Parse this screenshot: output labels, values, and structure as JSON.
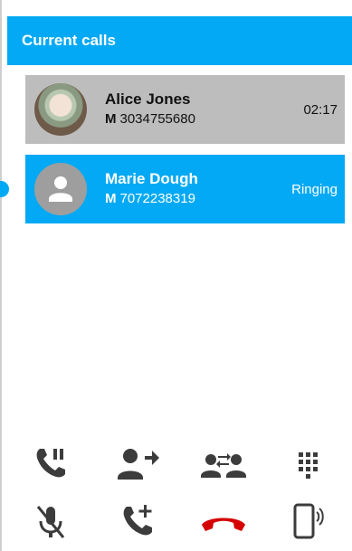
{
  "header": {
    "title": "Current calls"
  },
  "calls": [
    {
      "name": "Alice Jones",
      "number_type": "M",
      "number": "3034755680",
      "status": "02:17"
    },
    {
      "name": "Marie Dough",
      "number_type": "M",
      "number": "7072238319",
      "status": "Ringing"
    }
  ],
  "controls": {
    "row1": [
      "hold-call-icon",
      "transfer-call-icon",
      "swap-calls-icon",
      "dialpad-icon"
    ],
    "row2": [
      "mute-microphone-icon",
      "add-call-icon",
      "hang-up-icon",
      "phone-speaker-icon"
    ]
  },
  "colors": {
    "accent": "#03a9f4",
    "active_call_bg": "#bdbdbd",
    "hangup": "#d50000",
    "icon": "#3c3c3c"
  }
}
